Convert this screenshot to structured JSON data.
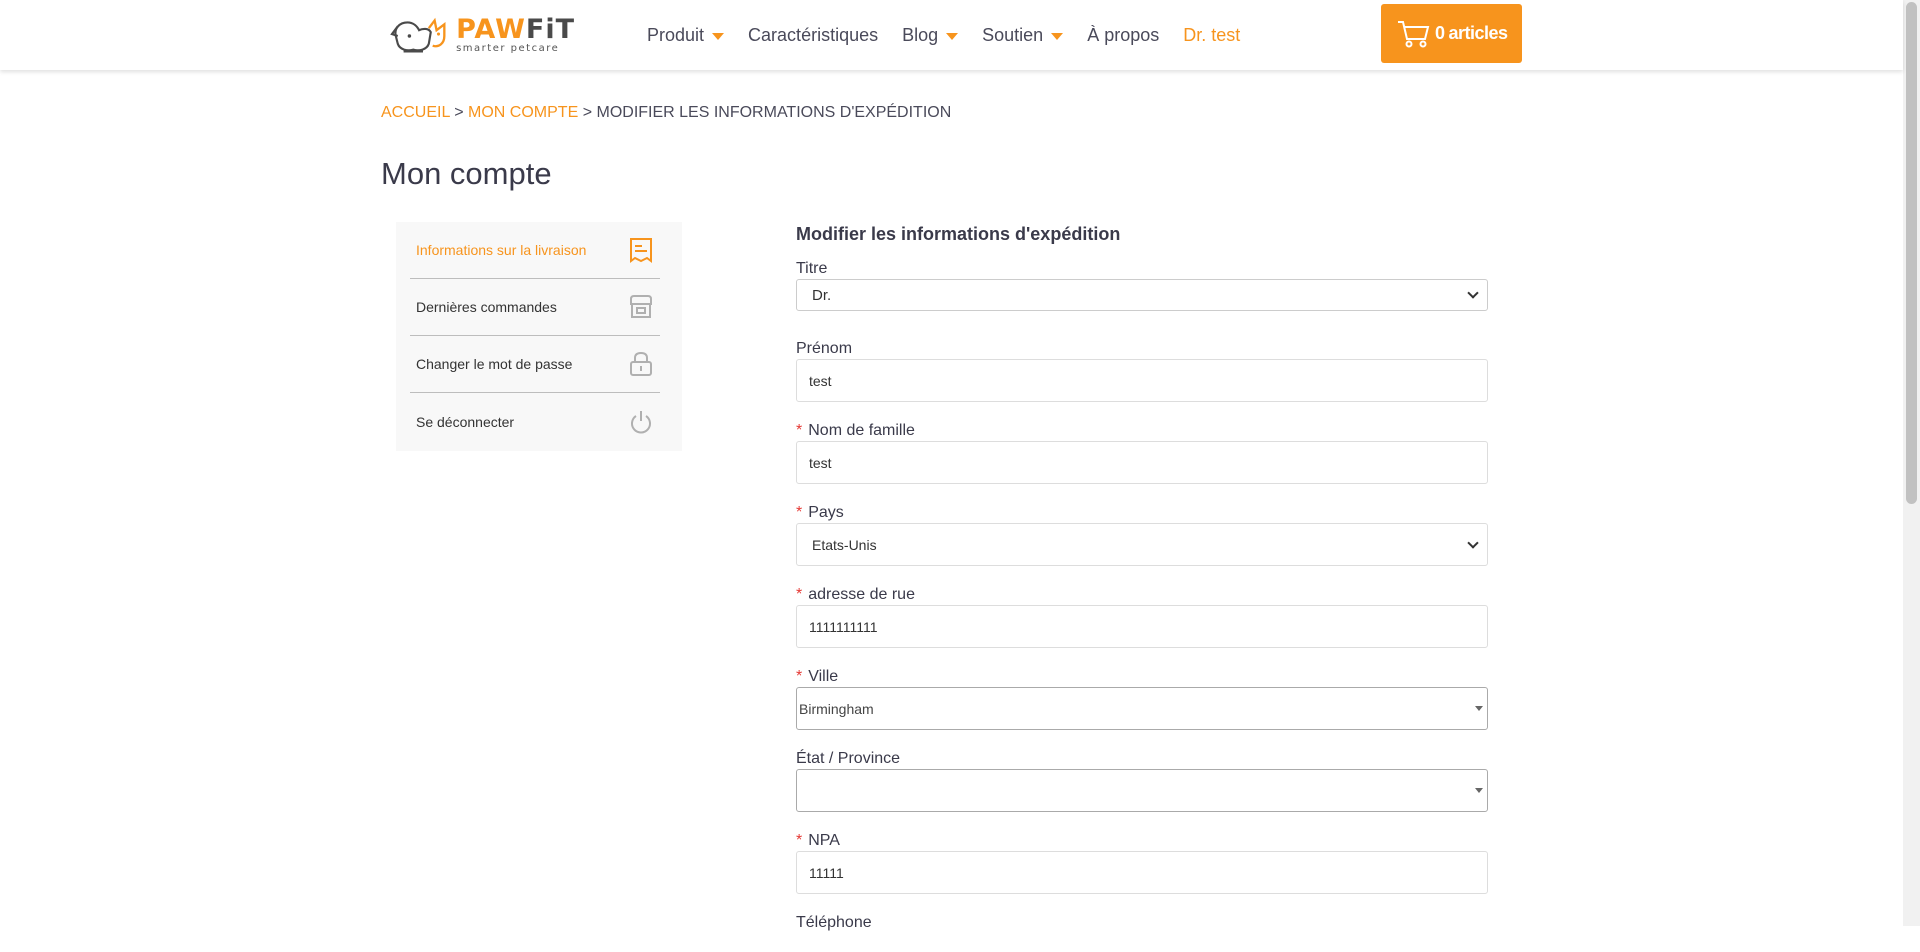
{
  "header": {
    "logo": {
      "word_a": "PAW",
      "word_b": "FiT",
      "tagline": "smarter petcare"
    },
    "nav": [
      {
        "label": "Produit",
        "dropdown": true
      },
      {
        "label": "Caractéristiques",
        "dropdown": false
      },
      {
        "label": "Blog",
        "dropdown": true
      },
      {
        "label": "Soutien",
        "dropdown": true
      },
      {
        "label": "À propos",
        "dropdown": false
      }
    ],
    "user_label": "Dr. test",
    "cart": {
      "count": "0",
      "label": "articles",
      "icon": "cart-icon"
    }
  },
  "breadcrumb": {
    "home": "ACCUEIL",
    "sep": ">",
    "account": "MON COMPTE",
    "current": "MODIFIER LES INFORMATIONS D'EXPÉDITION"
  },
  "page_title": "Mon compte",
  "sidebar": {
    "items": [
      {
        "label": "Informations sur la livraison",
        "icon": "receipt-icon",
        "active": true
      },
      {
        "label": "Dernières commandes",
        "icon": "store-icon",
        "active": false
      },
      {
        "label": "Changer le mot de passe",
        "icon": "lock-icon",
        "active": false
      },
      {
        "label": "Se déconnecter",
        "icon": "power-icon",
        "active": false
      }
    ]
  },
  "form": {
    "title": "Modifier les informations d'expédition",
    "required_mark": "*",
    "fields": {
      "title": {
        "label": "Titre",
        "value": "Dr."
      },
      "first_name": {
        "label": "Prénom",
        "value": "test"
      },
      "last_name": {
        "label": "Nom de famille",
        "value": "test"
      },
      "country": {
        "label": "Pays",
        "value": "Etats-Unis"
      },
      "street": {
        "label": "adresse de rue",
        "value": "1111111111"
      },
      "city": {
        "label": "Ville",
        "value": "Birmingham"
      },
      "state": {
        "label": "État / Province",
        "value": ""
      },
      "zip": {
        "label": "NPA",
        "value": "11111"
      },
      "phone": {
        "label": "Téléphone"
      }
    }
  },
  "colors": {
    "accent": "#f7941d",
    "text": "#3a3a4a",
    "required": "#e53935"
  }
}
